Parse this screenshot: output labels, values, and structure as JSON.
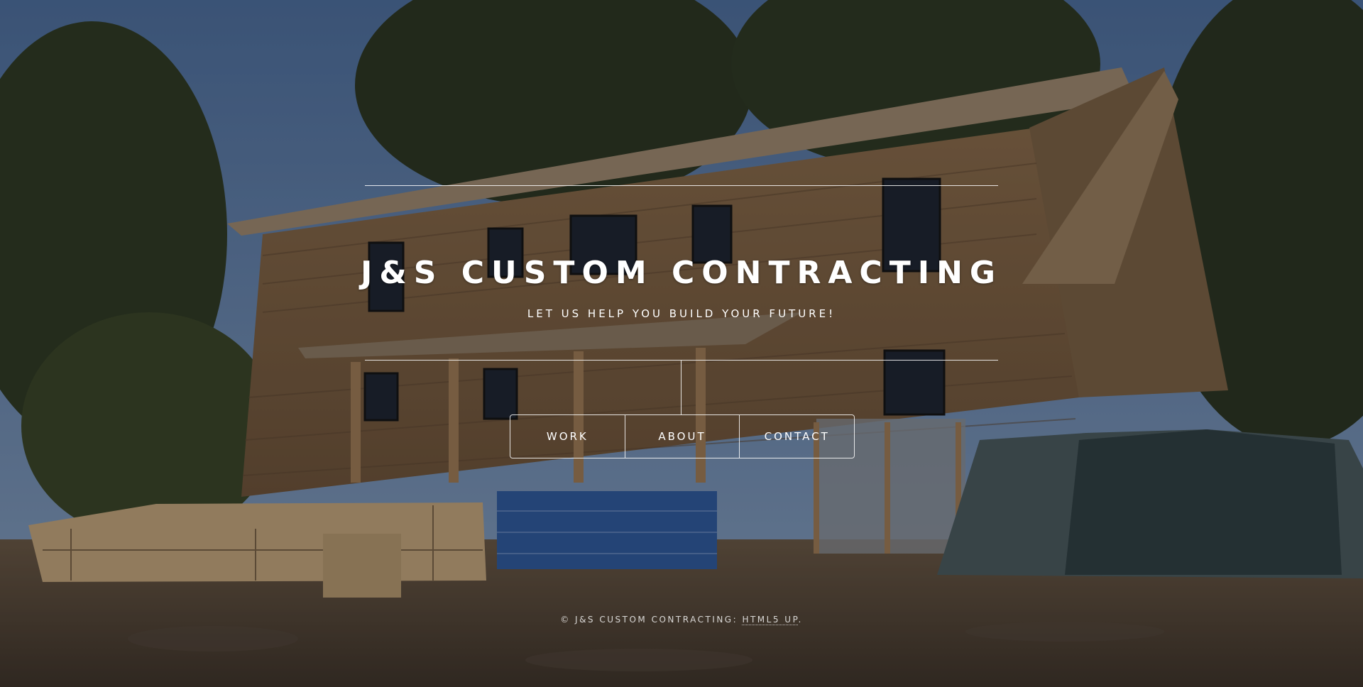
{
  "header": {
    "title": "J&S CUSTOM CONTRACTING",
    "tagline": "LET US HELP YOU BUILD YOUR FUTURE!"
  },
  "nav": {
    "items": [
      {
        "label": "WORK"
      },
      {
        "label": "ABOUT"
      },
      {
        "label": "CONTACT"
      }
    ]
  },
  "footer": {
    "copyright": "© J&S CUSTOM CONTRACTING: ",
    "credit_link": "HTML5 UP",
    "period": "."
  },
  "background": {
    "icon": "house-under-construction-photo"
  }
}
